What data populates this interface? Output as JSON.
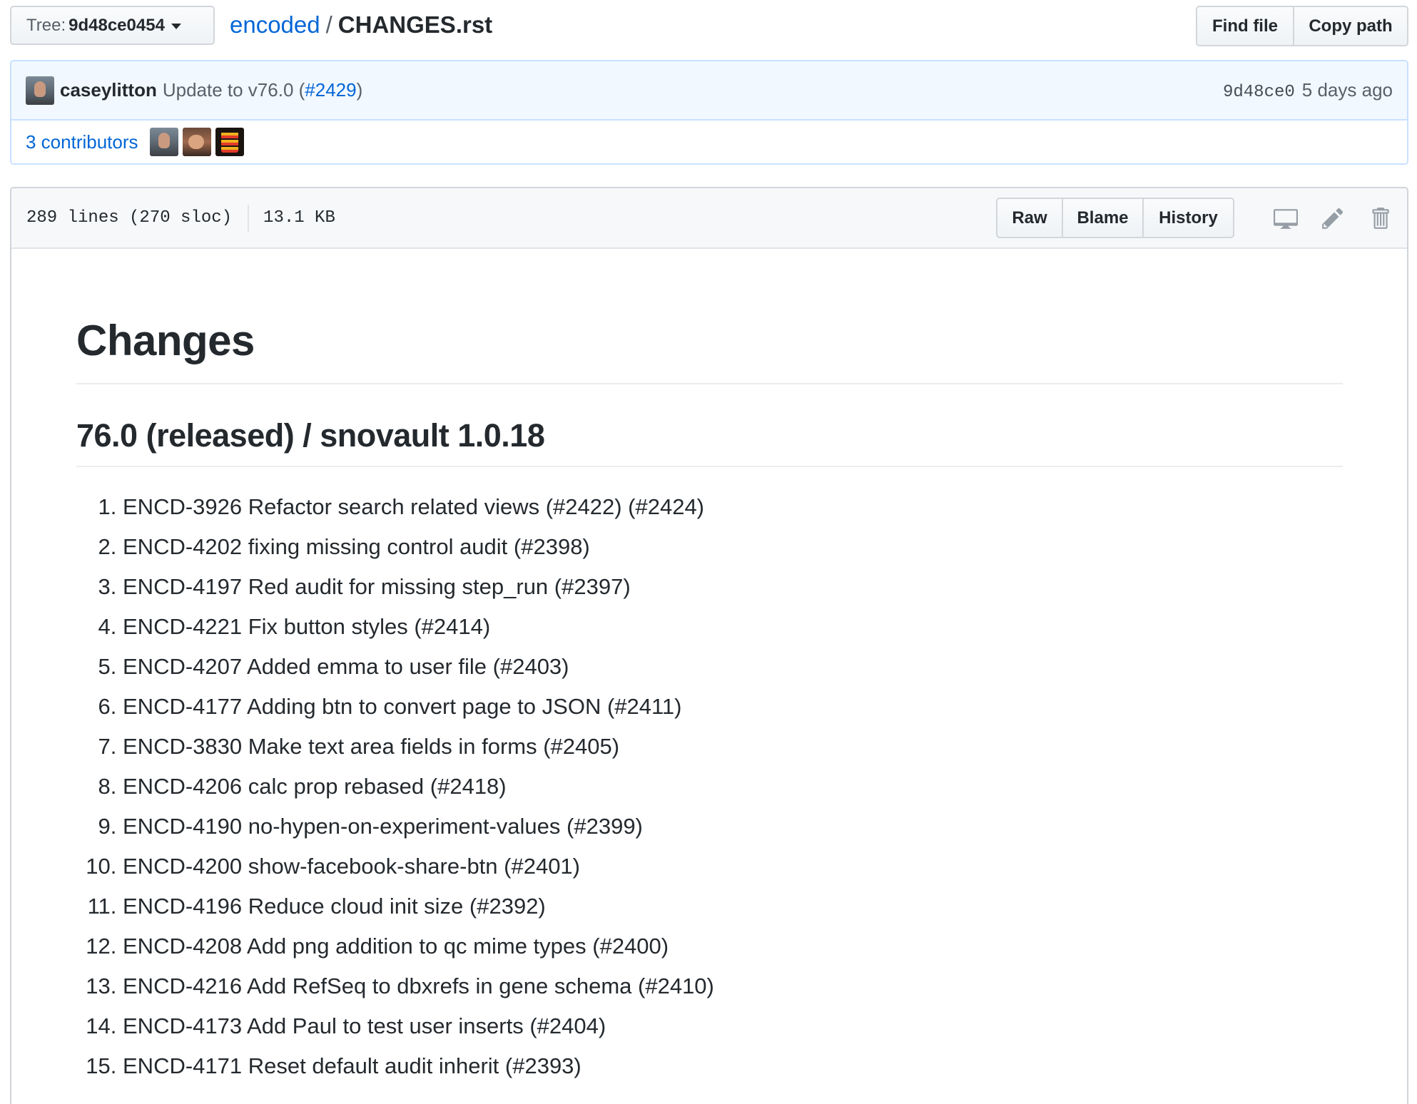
{
  "tree": {
    "label": "Tree:",
    "value": "9d48ce0454"
  },
  "breadcrumb": {
    "repo": "encoded",
    "separator": "/",
    "file": "CHANGES.rst"
  },
  "actions": {
    "find_file": "Find file",
    "copy_path": "Copy path"
  },
  "commit": {
    "author": "caseylitton",
    "message": "Update to v76.0 (",
    "pr_link": "#2429",
    "message_end": ")",
    "sha": "9d48ce0",
    "time": "5 days ago"
  },
  "contributors": {
    "label": "3 contributors",
    "avatars": [
      "contributor-avatar-1",
      "contributor-avatar-2",
      "contributor-avatar-3"
    ]
  },
  "file": {
    "lines": "289 lines (270 sloc)",
    "size": "13.1 KB",
    "buttons": {
      "raw": "Raw",
      "blame": "Blame",
      "history": "History"
    },
    "icons": [
      "desktop-icon",
      "pencil-icon",
      "trash-icon"
    ]
  },
  "content": {
    "title": "Changes",
    "subtitle": "76.0 (released) / snovault 1.0.18",
    "items": [
      "ENCD-3926 Refactor search related views (#2422) (#2424)",
      "ENCD-4202 fixing missing control audit (#2398)",
      "ENCD-4197 Red audit for missing step_run (#2397)",
      "ENCD-4221 Fix button styles (#2414)",
      "ENCD-4207 Added emma to user file (#2403)",
      "ENCD-4177 Adding btn to convert page to JSON (#2411)",
      "ENCD-3830 Make text area fields in forms (#2405)",
      "ENCD-4206 calc prop rebased (#2418)",
      "ENCD-4190 no-hypen-on-experiment-values (#2399)",
      "ENCD-4200 show-facebook-share-btn (#2401)",
      "ENCD-4196 Reduce cloud init size (#2392)",
      "ENCD-4208 Add png addition to qc mime types (#2400)",
      "ENCD-4216 Add RefSeq to dbxrefs in gene schema (#2410)",
      "ENCD-4173 Add Paul to test user inserts (#2404)",
      "ENCD-4171 Reset default audit inherit (#2393)"
    ]
  }
}
